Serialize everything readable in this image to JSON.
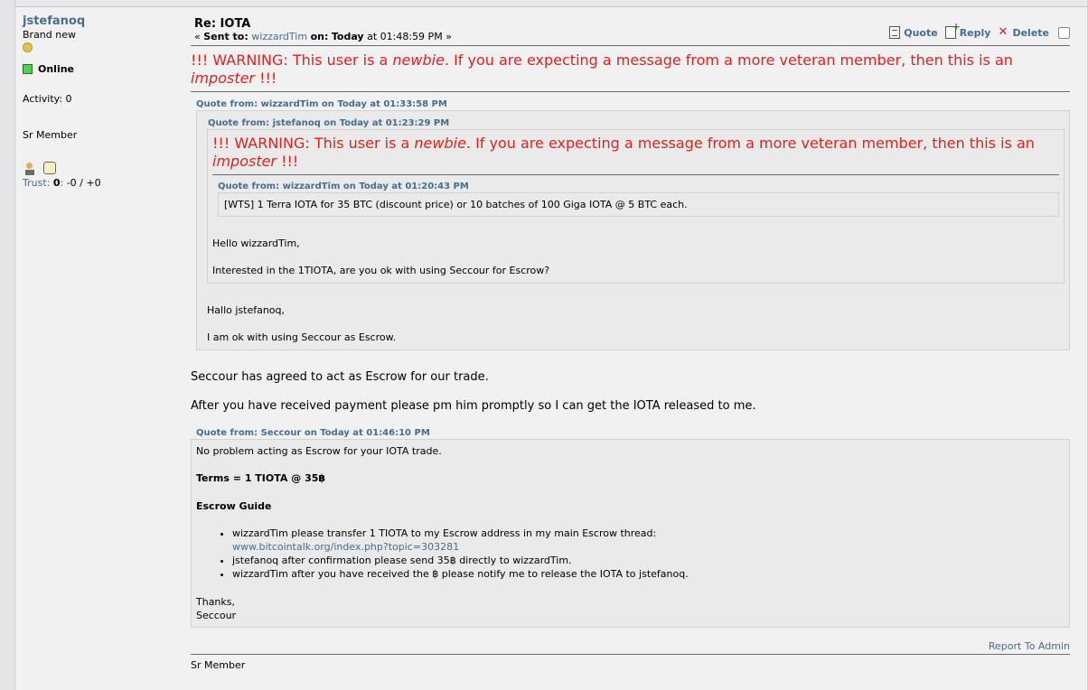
{
  "poster": {
    "username": "jstefanoq",
    "rank": "Brand new",
    "status": "Online",
    "activity": "Activity: 0",
    "title": "Sr Member",
    "trust_label": "Trust",
    "trust_value": "0",
    "trust_feedback": "-0 / +0"
  },
  "message": {
    "subject": "Re: IOTA",
    "sent_prefix": "« ",
    "sent_to_label": "Sent to:",
    "sent_to_user": "wizzardTim",
    "on_label": "on:",
    "date": "Today",
    "time": " at 01:48:59 PM »",
    "actions": {
      "quote": "Quote",
      "reply": "Reply",
      "delete": "Delete"
    },
    "warning_pre": "!!! WARNING: This user is a ",
    "warning_newbie": "newbie",
    "warning_mid": ". If you are expecting a message from a more veteran member, then this is an ",
    "warning_imposter": "imposter",
    "warning_end": " !!!",
    "quote1": {
      "header": "Quote from: wizzardTim on Today at 01:33:58 PM",
      "quote2": {
        "header": "Quote from: jstefanoq on Today at 01:23:29 PM",
        "quote3": {
          "header": "Quote from: wizzardTim on Today at 01:20:43 PM",
          "text": "[WTS] 1 Terra IOTA for 35 BTC (discount price) or 10 batches of 100 Giga IOTA @ 5 BTC each."
        },
        "line1": "Hello wizzardTim,",
        "line2": "Interested in the 1TIOTA, are you ok with using Seccour for Escrow?"
      },
      "line1": "Hallo jstefanoq,",
      "line2": "I am ok with using Seccour as Escrow."
    },
    "body1": "Seccour has agreed to act as Escrow for our trade.",
    "body2": "After you have received payment please pm him promptly so I can get the IOTA released to me.",
    "quote4": {
      "header": "Quote from: Seccour on Today at 01:46:10 PM",
      "line1": "No problem acting as Escrow for your IOTA trade.",
      "terms": "Terms = 1 TIOTA @ 35฿",
      "guide": "Escrow Guide",
      "items": [
        {
          "text": "wizzardTim please transfer 1 TIOTA to my Escrow address in my main Escrow thread:",
          "link": "www.bitcointalk.org/index.php?topic=303281"
        },
        {
          "text": "jstefanoq after confirmation please send 35฿ directly to wizzardTim.",
          "link": ""
        },
        {
          "text": "wizzardTim after you have received the ฿ please notify me to release the IOTA to jstefanoq.",
          "link": ""
        }
      ],
      "thanks": "Thanks,",
      "sign": "Seccour"
    },
    "report": "Report To Admin",
    "signature": "Sr Member"
  }
}
